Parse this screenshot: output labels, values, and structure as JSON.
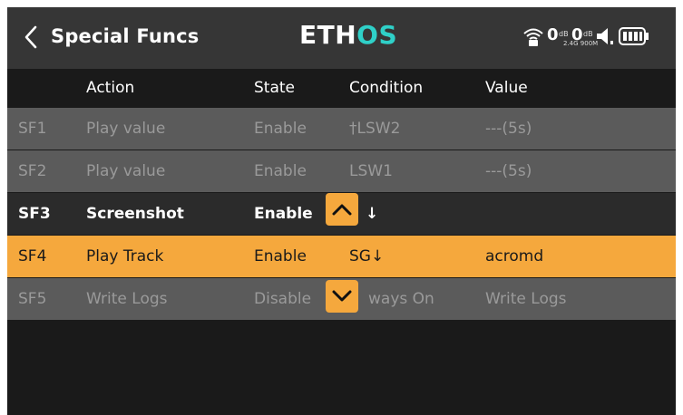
{
  "header": {
    "title": "Special Funcs",
    "logo_main": "ETH",
    "logo_accent": "OS",
    "status": {
      "rssi_1": "0",
      "rssi_2": "0",
      "db": "dB",
      "bands": "2.4G 900M"
    }
  },
  "columns": {
    "action": "Action",
    "state": "State",
    "condition": "Condition",
    "value": "Value"
  },
  "rows": [
    {
      "id": "SF1",
      "action": "Play value",
      "state": "Enable",
      "condition": "†LSW2",
      "value": "---(5s)"
    },
    {
      "id": "SF2",
      "action": "Play value",
      "state": "Enable",
      "condition": "LSW1",
      "value": "---(5s)"
    },
    {
      "id": "SF3",
      "action": "Screenshot",
      "state": "Enable",
      "condition": "↓",
      "value": ""
    },
    {
      "id": "SF4",
      "action": "Play Track",
      "state": "Enable",
      "condition": "SG↓",
      "value": "acromd"
    },
    {
      "id": "SF5",
      "action": "Write Logs",
      "state": "Disable",
      "condition": "ways On",
      "value": "Write Logs"
    }
  ],
  "colors": {
    "accent": "#f5a83d",
    "logo_accent": "#2fd0c8",
    "dim_row": "#5b5b5b"
  },
  "icons": {
    "back": "chevron-left-icon",
    "up": "chevron-up-icon",
    "down": "chevron-down-icon"
  }
}
